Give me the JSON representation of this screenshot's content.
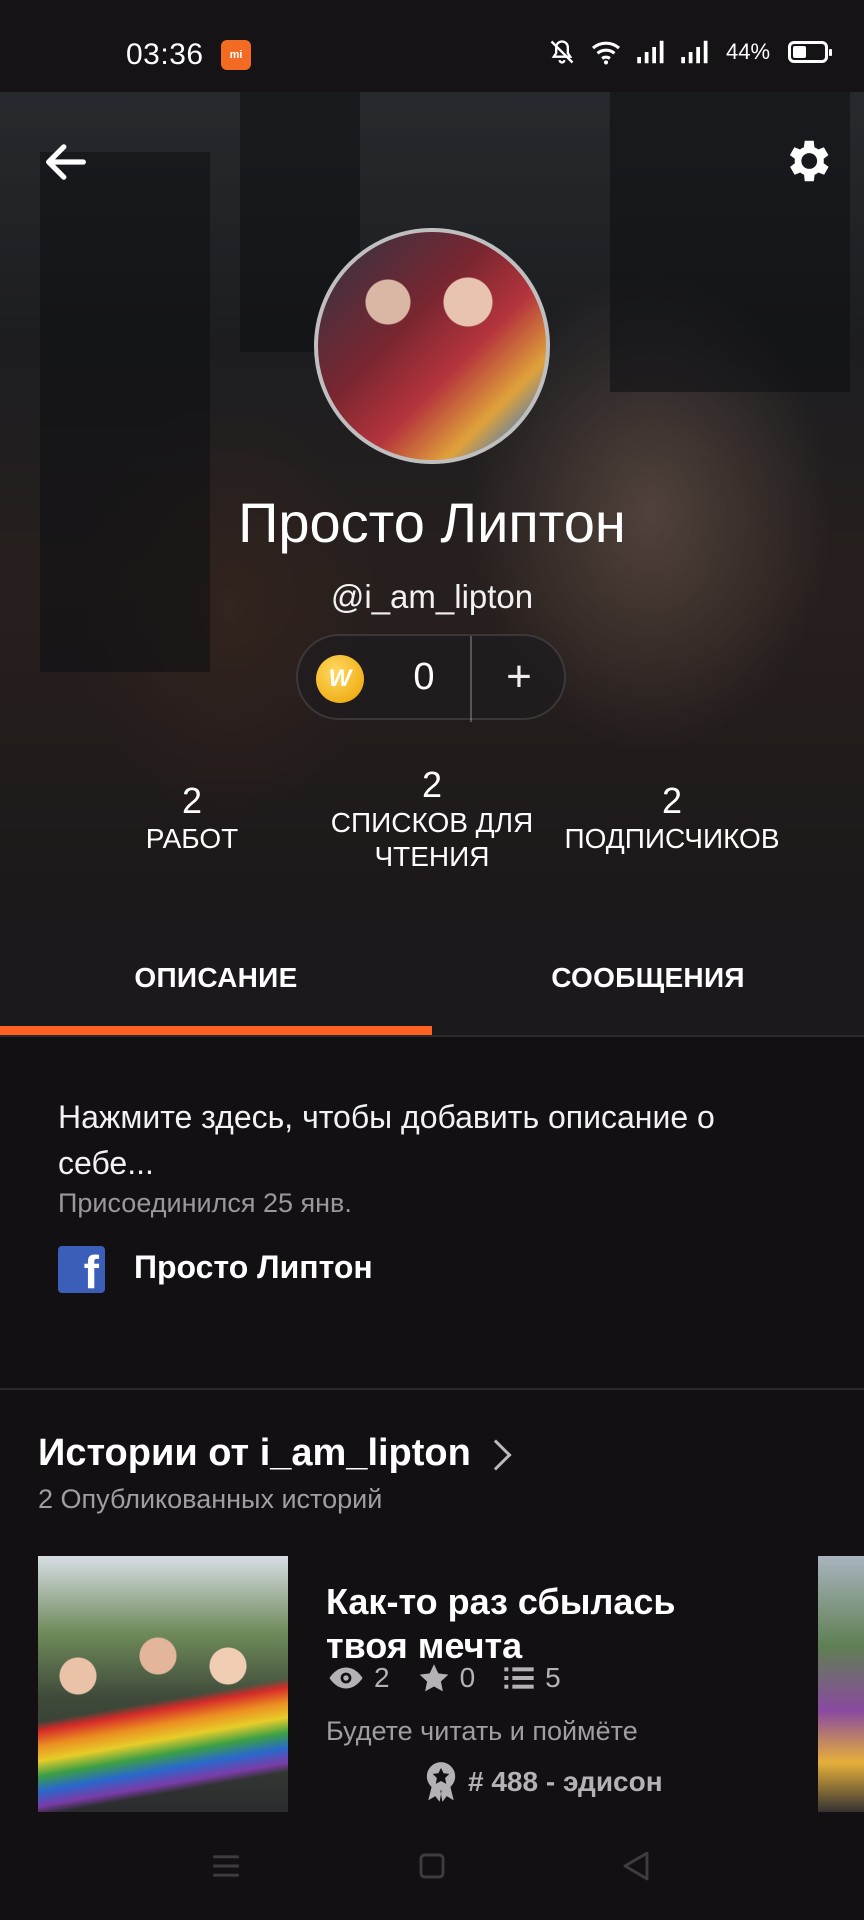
{
  "status_bar": {
    "time": "03:36",
    "mi_badge": "mi",
    "battery_text": "44%",
    "battery_level": 0.44,
    "icons": [
      "bell-off-icon",
      "wifi-icon",
      "signal-icon",
      "signal-icon",
      "battery-icon"
    ]
  },
  "header": {
    "back_icon": "arrow-left-icon",
    "settings_icon": "gear-icon"
  },
  "profile": {
    "name": "Просто Липтон",
    "handle": "@i_am_lipton",
    "coins": "0",
    "coin_icon_label": "W",
    "add_label": "+"
  },
  "stats": {
    "works": {
      "value": "2",
      "label": "РАБОТ"
    },
    "lists": {
      "value": "2",
      "label": "СПИСКОВ ДЛЯ ЧТЕНИЯ"
    },
    "followers": {
      "value": "2",
      "label": "ПОДПИСЧИКОВ"
    }
  },
  "tabs": [
    {
      "label": "ОПИСАНИЕ",
      "active": true
    },
    {
      "label": "СООБЩЕНИЯ",
      "active": false
    }
  ],
  "about": {
    "placeholder": "Нажмите здесь, чтобы добавить описание о себе...",
    "joined": "Присоединился 25 янв.",
    "facebook_name": "Просто Липтон"
  },
  "stories": {
    "title": "Истории от i_am_lipton",
    "subtitle": "2 Опубликованных историй",
    "items": [
      {
        "title": "Как-то раз сбылась твоя мечта",
        "views": "2",
        "votes": "0",
        "parts": "5",
        "description": "Будете читать и поймёте",
        "rank": "# 488 - эдисон"
      }
    ]
  },
  "colors": {
    "accent": "#ff6122",
    "background": "#121013",
    "tab_bar": "#1b191c",
    "facebook": "#3b5fb8"
  }
}
